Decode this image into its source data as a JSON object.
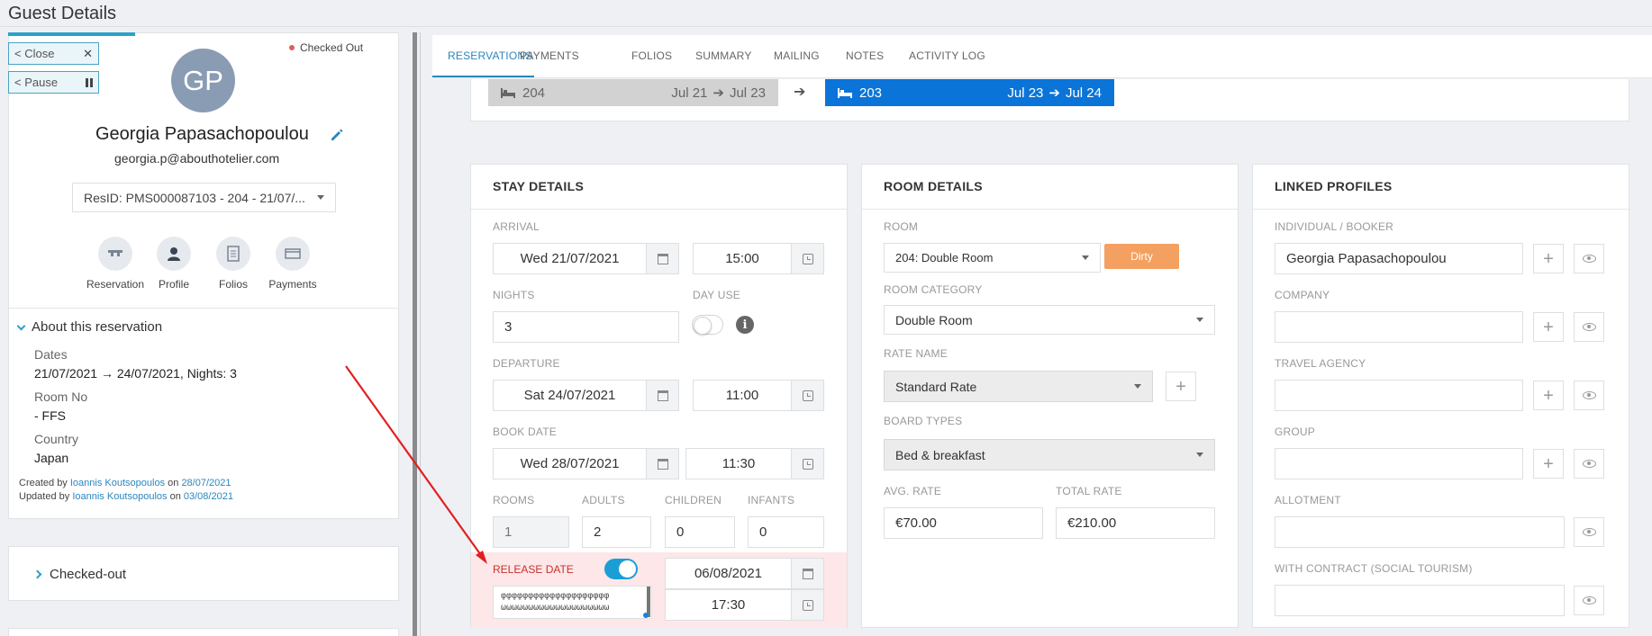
{
  "page": {
    "title": "Guest Details"
  },
  "left": {
    "close_label": "< Close",
    "pause_label": "< Pause",
    "status": "Checked Out",
    "avatar_initials": "GP",
    "guest_name": "Georgia Papasachopoulou",
    "guest_email": "georgia.p@abouthotelier.com",
    "resid": "ResID: PMS000087103 - 204 - 21/07/...",
    "quick_actions": [
      {
        "label": "Reservation",
        "icon": "reception-bell-icon"
      },
      {
        "label": "Profile",
        "icon": "user-icon"
      },
      {
        "label": "Folios",
        "icon": "document-icon"
      },
      {
        "label": "Payments",
        "icon": "payment-card-icon"
      }
    ],
    "about": {
      "title": "About this reservation",
      "dates_label": "Dates",
      "dates_value": "21/07/2021 → 24/07/2021, Nights: 3",
      "room_label": "Room No",
      "room_value": "- FFS",
      "country_label": "Country",
      "country_value": "Japan",
      "created_prefix": "Created by",
      "created_by": "Ioannis Koutsopoulos",
      "created_on_word": "on",
      "created_on": "28/07/2021",
      "updated_prefix": "Updated by",
      "updated_by": "Ioannis Koutsopoulos",
      "updated_on_word": "on",
      "updated_on": "03/08/2021"
    },
    "checked_out_title": "Checked-out"
  },
  "tabs": [
    {
      "label": "RESERVATIONS",
      "active": true
    },
    {
      "label": "PAYMENTS"
    },
    {
      "label": "FOLIOS"
    },
    {
      "label": "SUMMARY"
    },
    {
      "label": "MAILING"
    },
    {
      "label": "NOTES"
    },
    {
      "label": "ACTIVITY LOG"
    }
  ],
  "route": {
    "from_room": "204",
    "from_start": "Jul 21",
    "from_end": "Jul 23",
    "to_room": "203",
    "to_start": "Jul 23",
    "to_end": "Jul 24"
  },
  "stay": {
    "title": "STAY DETAILS",
    "arrival_label": "ARRIVAL",
    "arrival_date": "Wed 21/07/2021",
    "arrival_time": "15:00",
    "nights_label": "NIGHTS",
    "nights_value": "3",
    "day_use_label": "DAY USE",
    "day_use_on": false,
    "departure_label": "DEPARTURE",
    "departure_date": "Sat 24/07/2021",
    "departure_time": "11:00",
    "book_label": "BOOK DATE",
    "book_date": "Wed 28/07/2021",
    "book_time": "11:30",
    "rooms_label": "ROOMS",
    "rooms_value": "1",
    "adults_label": "ADULTS",
    "adults_value": "2",
    "children_label": "CHILDREN",
    "children_value": "0",
    "infants_label": "INFANTS",
    "infants_value": "0",
    "release_label": "RELEASE DATE",
    "release_on": true,
    "release_date": "06/08/2021",
    "release_time": "17:30",
    "release_note": "φφφφφφφφφφφφφφφφφφφφ\nωωωωωωωωωωωωωωωωωωωω"
  },
  "room": {
    "title": "ROOM DETAILS",
    "room_label": "ROOM",
    "room_value": "204: Double Room",
    "status_badge": "Dirty",
    "category_label": "ROOM CATEGORY",
    "category_value": "Double Room",
    "rate_label": "RATE NAME",
    "rate_value": "Standard Rate",
    "board_label": "BOARD TYPES",
    "board_value": "Bed & breakfast",
    "avg_label": "AVG. RATE",
    "avg_value": "€70.00",
    "total_label": "TOTAL RATE",
    "total_value": "€210.00"
  },
  "linked": {
    "title": "LINKED PROFILES",
    "booker_label": "INDIVIDUAL / BOOKER",
    "booker_value": "Georgia Papasachopoulou",
    "company_label": "COMPANY",
    "agency_label": "TRAVEL AGENCY",
    "group_label": "GROUP",
    "allotment_label": "ALLOTMENT",
    "contract_label": "WITH CONTRACT (SOCIAL TOURISM)"
  },
  "colors": {
    "accent": "#2a86bd",
    "new_room_chip": "#0a74d8",
    "dirty_badge": "#f4a061",
    "release_bg": "#fde7e8",
    "annotation_arrow": "#e02020"
  }
}
